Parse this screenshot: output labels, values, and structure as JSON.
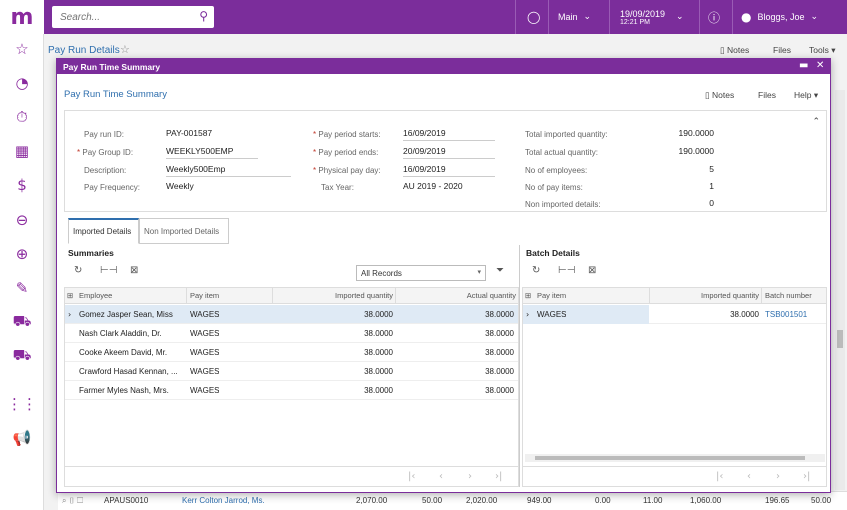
{
  "app": {
    "logo": "m"
  },
  "topbar": {
    "search_placeholder": "Search...",
    "workspace": "Main",
    "date": "19/09/2019",
    "time": "12:21 PM",
    "user": "Bloggs, Joe"
  },
  "rail": {
    "icons": [
      "star-icon",
      "pie-chart-icon",
      "stopwatch-icon",
      "calculator-icon",
      "dollar-icon",
      "minus-circle-icon",
      "plus-circle-icon",
      "edit-icon",
      "cart-icon",
      "truck-icon",
      "grid-icon",
      "megaphone-icon"
    ]
  },
  "background": {
    "title": "Pay Run Details",
    "notes": "Notes",
    "files": "Files",
    "tools": "Tools",
    "row": {
      "id": "APAUS0010",
      "name": "Kerr Colton Jarrod, Ms.",
      "v1": "2,070.00",
      "v2": "50.00",
      "v3": "2,020.00",
      "v4": "949.00",
      "v5": "0.00",
      "v6": "11.00",
      "v7": "1,060.00",
      "v8": "196.65",
      "v9": "50.00"
    }
  },
  "modal": {
    "title": "Pay Run Time Summary",
    "header": "Pay Run Time Summary",
    "notes": "Notes",
    "files": "Files",
    "help": "Help",
    "summary": {
      "pay_run_id_label": "Pay run ID:",
      "pay_run_id": "PAY-001587",
      "pay_group_label": "Pay Group ID:",
      "pay_group": "WEEKLY500EMP",
      "description_label": "Description:",
      "description": "Weekly500Emp",
      "frequency_label": "Pay Frequency:",
      "frequency": "Weekly",
      "period_start_label": "Pay period starts:",
      "period_start": "16/09/2019",
      "period_end_label": "Pay period ends:",
      "period_end": "20/09/2019",
      "pay_day_label": "Physical pay day:",
      "pay_day": "16/09/2019",
      "tax_year_label": "Tax Year:",
      "tax_year": "AU  2019 - 2020",
      "total_imported_label": "Total imported quantity:",
      "total_imported": "190.0000",
      "total_actual_label": "Total actual quantity:",
      "total_actual": "190.0000",
      "employees_label": "No of employees:",
      "employees": "5",
      "pay_items_label": "No of pay items:",
      "pay_items": "1",
      "non_imported_label": "Non imported details:",
      "non_imported": "0"
    },
    "tabs": [
      "Imported Details",
      "Non Imported Details"
    ],
    "summaries": {
      "title": "Summaries",
      "filter": "All Records",
      "columns": [
        "Employee",
        "Pay item",
        "Imported quantity",
        "Actual quantity"
      ],
      "rows": [
        [
          "Gomez Jasper Sean, Miss",
          "WAGES",
          "38.0000",
          "38.0000"
        ],
        [
          "Nash Clark Aladdin, Dr.",
          "WAGES",
          "38.0000",
          "38.0000"
        ],
        [
          "Cooke Akeem David, Mr.",
          "WAGES",
          "38.0000",
          "38.0000"
        ],
        [
          "Crawford Hasad Kennan, ...",
          "WAGES",
          "38.0000",
          "38.0000"
        ],
        [
          "Farmer Myles Nash, Mrs.",
          "WAGES",
          "38.0000",
          "38.0000"
        ]
      ]
    },
    "batch": {
      "title": "Batch Details",
      "columns": [
        "Pay item",
        "Imported quantity",
        "Batch number"
      ],
      "rows": [
        [
          "WAGES",
          "38.0000",
          "TSB001501"
        ]
      ]
    }
  },
  "colors": {
    "brand": "#7b2d9b",
    "link": "#2f6fae",
    "selected_row": "#dfeaf5"
  }
}
